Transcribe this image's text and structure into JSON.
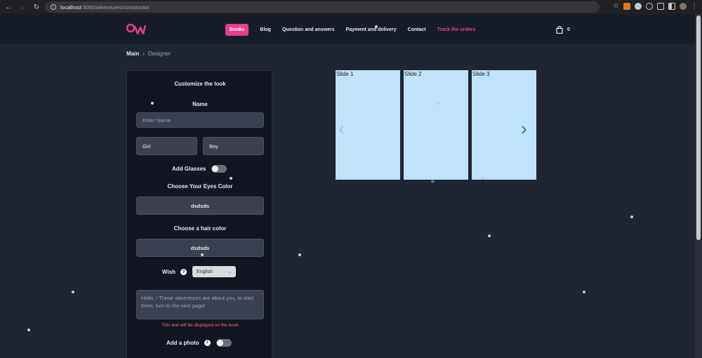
{
  "browser": {
    "url_host": "localhost",
    "url_path": ":3000/adventures/constructor"
  },
  "header": {
    "nav": [
      {
        "label": "Books",
        "state": "active"
      },
      {
        "label": "Blog"
      },
      {
        "label": "Question and answers"
      },
      {
        "label": "Payment and delivery"
      },
      {
        "label": "Contact"
      },
      {
        "label": "Track the orders",
        "state": "highlight"
      }
    ],
    "cart_count": "0"
  },
  "breadcrumb": {
    "main": "Main",
    "current": "Designer"
  },
  "panel": {
    "title": "Customize the look",
    "name_label": "Name",
    "name_placeholder": "Enter Name",
    "gender_options": [
      "Girl",
      "Boy"
    ],
    "glasses_label": "Add Glasses",
    "eyes_label": "Choose Your Eyes Color",
    "eyes_value": "dsdsds",
    "hair_label": "Choose a hair color",
    "hair_value": "dsdsds",
    "wish_label": "Wish",
    "wish_language": "English",
    "wish_text": "Hello, ! These adventures are about you, to start them, turn to the next page!",
    "wish_note": "This text will be displayed on the book",
    "photo_label": "Add a photo"
  },
  "slides": [
    "Slide 1",
    "Slide 2",
    "Slide 3"
  ],
  "colors": {
    "accent": "#e83e8c",
    "background": "#1f2532",
    "panel": "#111622",
    "slide": "#bfe3fb"
  }
}
